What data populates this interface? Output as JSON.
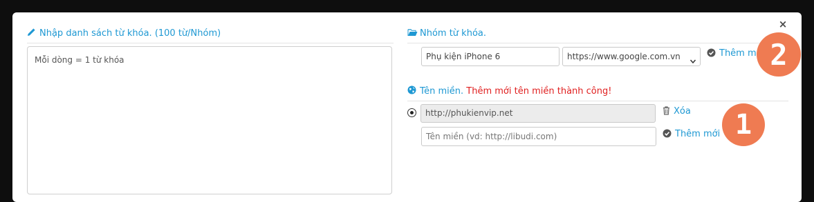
{
  "dialog": {
    "close_label": "×"
  },
  "keywords_panel": {
    "title": "Nhập danh sách từ khóa. (100 từ/Nhóm)",
    "textarea_placeholder": "Mỗi dòng = 1 từ khóa"
  },
  "group_panel": {
    "title": "Nhóm từ khóa.",
    "name_value": "Phụ kiện iPhone 6",
    "engine_selected": "https://www.google.com.vn",
    "add_label": "Thêm mới"
  },
  "domain_panel": {
    "title": "Tên miền.",
    "status_message": "Thêm mới tên miền thành công!",
    "existing_domain": "http://phukienvip.net",
    "delete_label": "Xóa",
    "new_domain_placeholder": "Tên miền (vd: http://libudi.com)",
    "add_label": "Thêm mới"
  },
  "annotations": {
    "badge_1": "1",
    "badge_2": "2"
  },
  "colors": {
    "accent": "#1e98d3",
    "error": "#e02020",
    "badge": "#ef7b52"
  }
}
